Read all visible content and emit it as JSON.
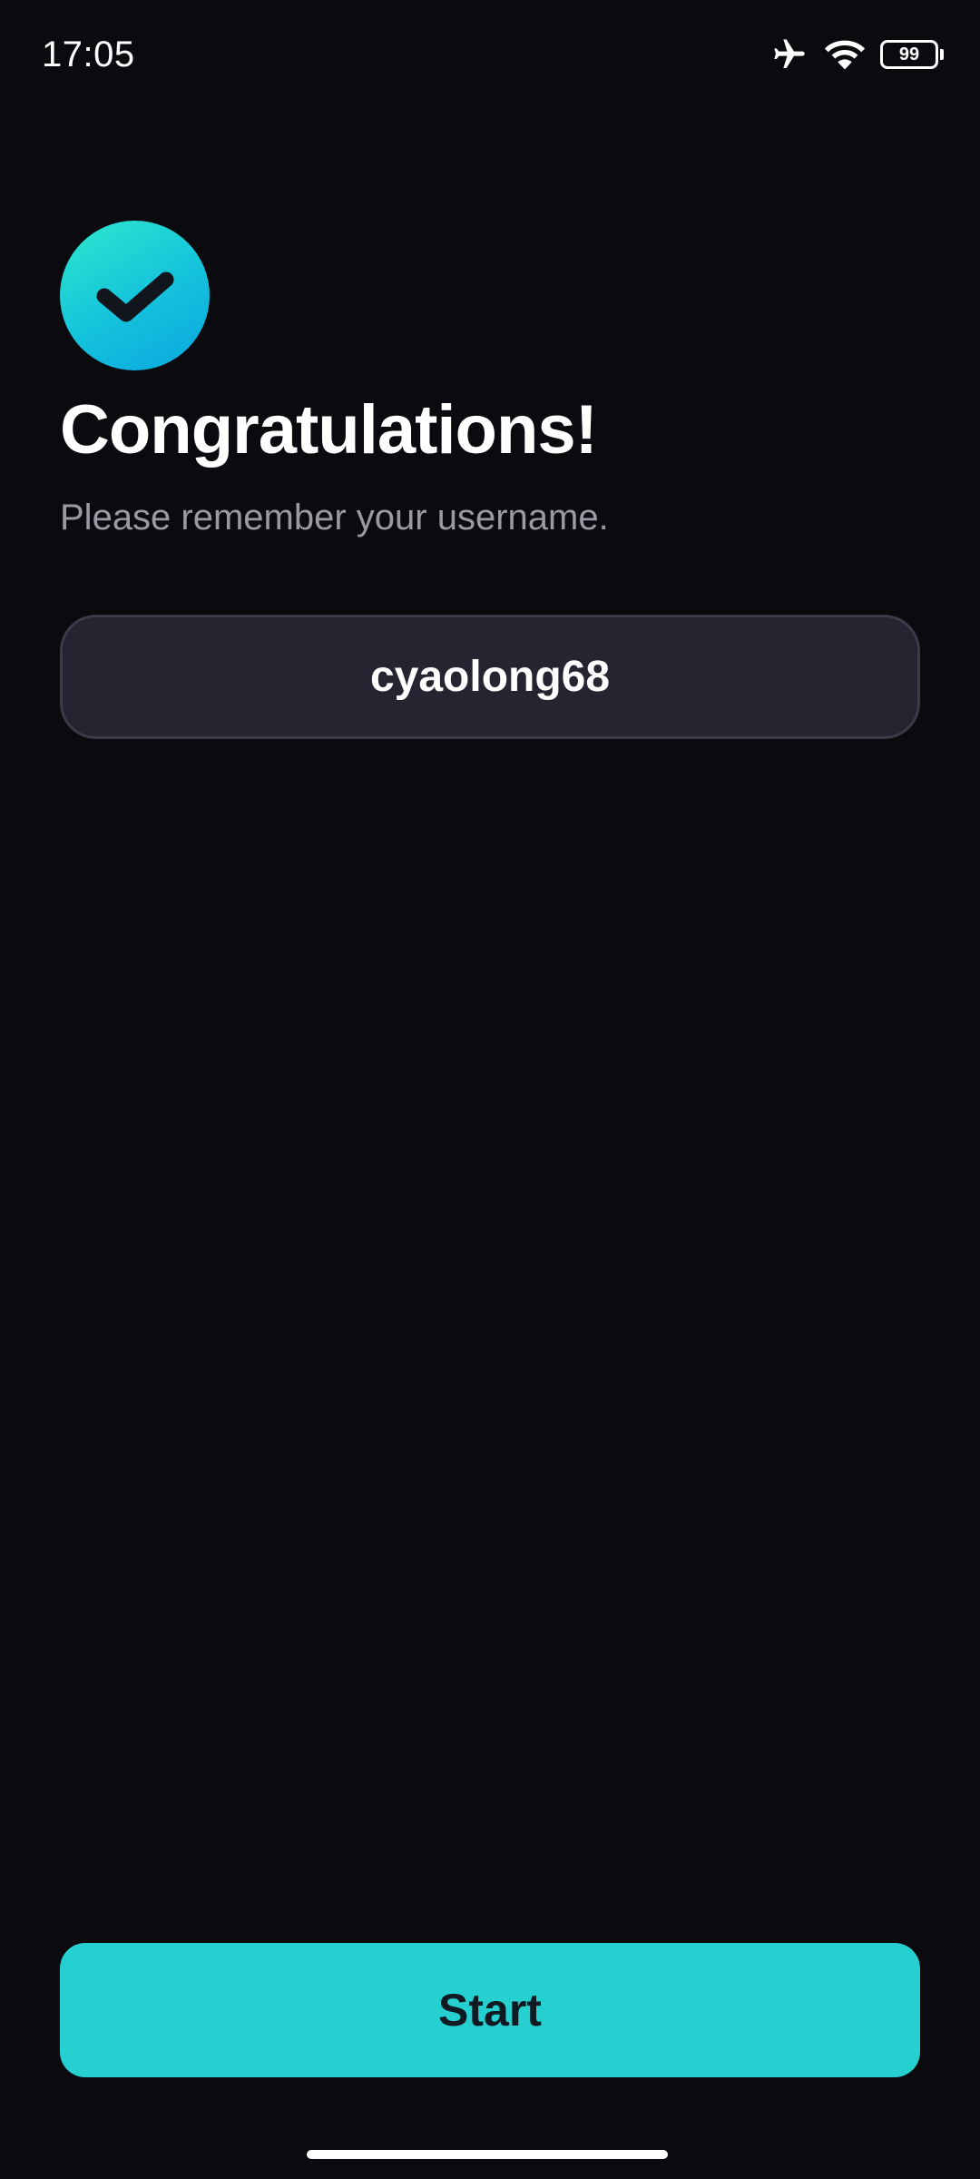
{
  "status_bar": {
    "time": "17:05",
    "battery_level": "99",
    "icons": [
      "airplane-mode-icon",
      "wifi-icon",
      "battery-icon"
    ]
  },
  "success_icon": "check-icon",
  "title": "Congratulations!",
  "subtitle": "Please remember your username.",
  "username": "cyaolong68",
  "start_button": {
    "label": "Start"
  },
  "colors": {
    "background": "#0b0b0f",
    "accent": "#26d0d0",
    "badge_gradient_start": "#2ee8cc",
    "badge_gradient_end": "#0aa6e0",
    "username_box": "#242530",
    "subtitle_text": "#9a9aa2"
  }
}
